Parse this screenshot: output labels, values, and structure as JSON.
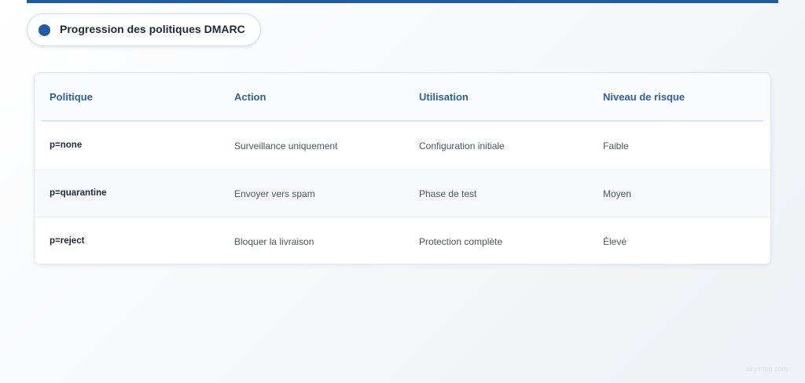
{
  "title": "Progression des politiques DMARC",
  "table": {
    "headers": [
      "Politique",
      "Action",
      "Utilisation",
      "Niveau de risque"
    ],
    "rows": [
      [
        "p=none",
        "Surveillance uniquement",
        "Configuration initiale",
        "Faible"
      ],
      [
        "p=quarantine",
        "Envoyer vers spam",
        "Phase de test",
        "Moyen"
      ],
      [
        "p=reject",
        "Bloquer la livraison",
        "Protection complète",
        "Élevé"
      ]
    ]
  },
  "watermark": "skysnag.com",
  "colors": {
    "accent": "#1c5da6",
    "header_text": "#2a64a8"
  }
}
